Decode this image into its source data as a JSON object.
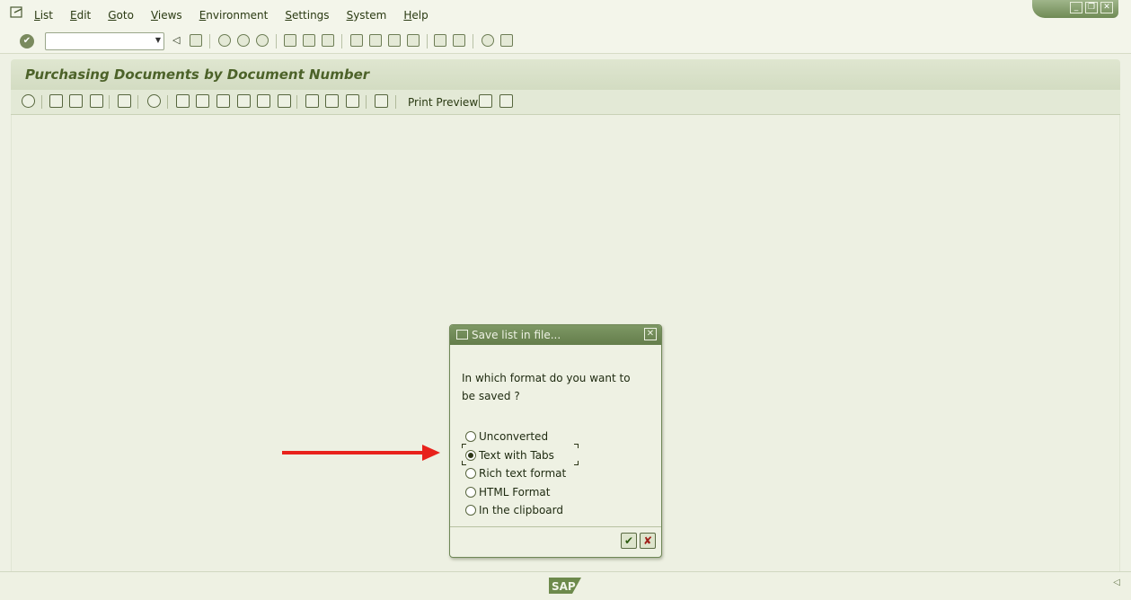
{
  "menubar": {
    "items": [
      "List",
      "Edit",
      "Goto",
      "Views",
      "Environment",
      "Settings",
      "System",
      "Help"
    ]
  },
  "window_controls": [
    "_",
    "❐",
    "✕"
  ],
  "std_toolbar": {
    "command_field_value": ""
  },
  "page": {
    "title": "Purchasing Documents by Document Number"
  },
  "app_toolbar": {
    "print_preview_label": "Print Preview"
  },
  "dialog": {
    "title": "Save list in file...",
    "question": "In which format do you want to be saved ?",
    "options": [
      {
        "label": "Unconverted",
        "selected": false
      },
      {
        "label": "Text with Tabs",
        "selected": true
      },
      {
        "label": "Rich text format",
        "selected": false
      },
      {
        "label": "HTML Format",
        "selected": false
      },
      {
        "label": "In the clipboard",
        "selected": false
      }
    ],
    "ok_icon": "checkmark-icon",
    "cancel_icon": "cancel-x-icon"
  },
  "annotation": {
    "arrow_color": "#e8221b"
  },
  "statusbar": {
    "logo_text": "SAP"
  },
  "colors": {
    "background": "#eef1e4",
    "title_text": "#4c6229",
    "dialog_titlebar": "#6f8a55"
  }
}
